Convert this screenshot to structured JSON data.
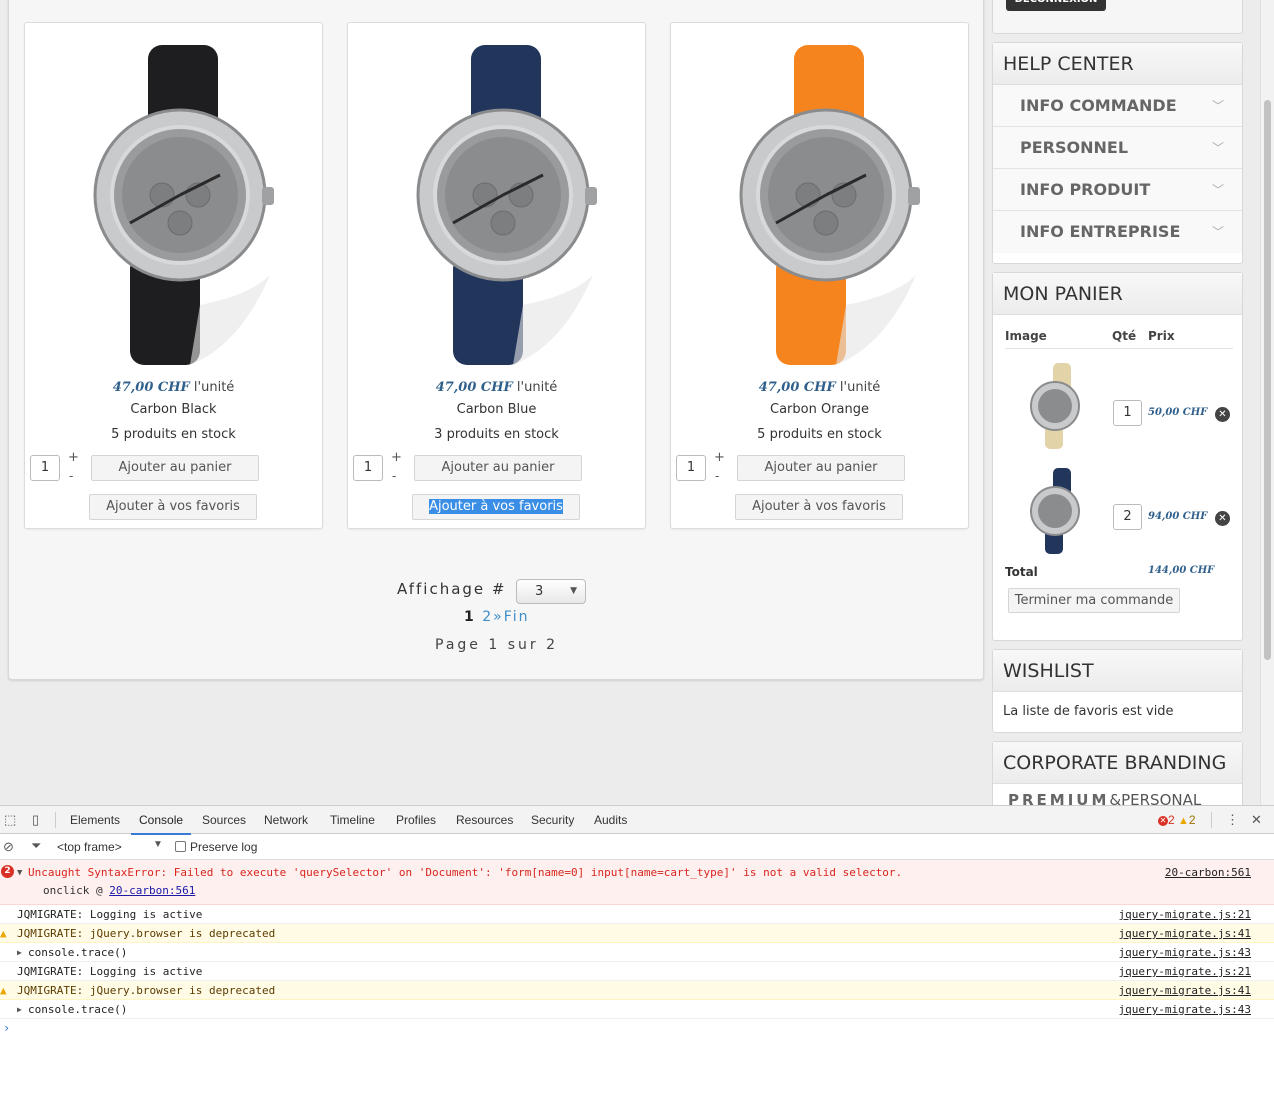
{
  "products": [
    {
      "price": "47,00 CHF",
      "unit": "l'unité",
      "name": "Carbon Black",
      "stock": "5 produits en stock",
      "qty": "1",
      "plus": "+",
      "minus": "-",
      "add_cart": "Ajouter au panier",
      "add_fav": "Ajouter à vos favoris",
      "strap_color": "#1e1e20"
    },
    {
      "price": "47,00 CHF",
      "unit": "l'unité",
      "name": "Carbon Blue",
      "stock": "3 produits en stock",
      "qty": "1",
      "plus": "+",
      "minus": "-",
      "add_cart": "Ajouter au panier",
      "add_fav": "Ajouter à vos favoris",
      "strap_color": "#22365c"
    },
    {
      "price": "47,00 CHF",
      "unit": "l'unité",
      "name": "Carbon Orange",
      "stock": "5 produits en stock",
      "qty": "1",
      "plus": "+",
      "minus": "-",
      "add_cart": "Ajouter au panier",
      "add_fav": "Ajouter à vos favoris",
      "strap_color": "#f5841f"
    }
  ],
  "pagination": {
    "affichage_label": "Affichage #",
    "affichage_value": "3",
    "page_current": "1",
    "page_next": "2",
    "next_arrow": "»",
    "last": "Fin",
    "page_of": "Page 1 sur 2"
  },
  "sidebar": {
    "logout": "DÉCONNEXION",
    "help_title": "HELP CENTER",
    "help_items": [
      "INFO COMMANDE",
      "PERSONNEL",
      "INFO PRODUIT",
      "INFO ENTREPRISE"
    ],
    "cart_title": "MON PANIER",
    "cart_headers": {
      "image": "Image",
      "qty": "Qté",
      "price": "Prix"
    },
    "cart_items": [
      {
        "qty": "1",
        "price": "50,00 CHF",
        "strap_color": "#e3d3a8"
      },
      {
        "qty": "2",
        "price": "94,00 CHF",
        "strap_color": "#22365c"
      }
    ],
    "total_label": "Total",
    "total_value": "144,00 CHF",
    "checkout": "Terminer ma commande",
    "wishlist_title": "WISHLIST",
    "wishlist_empty": "La liste de favoris est vide",
    "branding_title": "CORPORATE BRANDING",
    "branding_premium": "PREMIUM",
    "branding_amp": "&",
    "branding_personal": "PERSONAL"
  },
  "devtools": {
    "tabs": [
      "Elements",
      "Console",
      "Sources",
      "Network",
      "Timeline",
      "Profiles",
      "Resources",
      "Security",
      "Audits"
    ],
    "active_tab": "Console",
    "error_count": "2",
    "warning_count": "2",
    "frame": "<top frame>",
    "preserve_log": "Preserve log",
    "error": {
      "message": "Uncaught SyntaxError: Failed to execute 'querySelector' on 'Document': 'form[name=0] input[name=cart_type]' is not a valid selector.",
      "onclick_prefix": "onclick @ ",
      "onclick_link": "20-carbon:561",
      "source": "20-carbon:561"
    },
    "logs": [
      {
        "type": "log",
        "text": "JQMIGRATE: Logging is active",
        "source": "jquery-migrate.js:21"
      },
      {
        "type": "warn",
        "text": "JQMIGRATE: jQuery.browser is deprecated",
        "source": "jquery-migrate.js:41"
      },
      {
        "type": "trace",
        "text": "console.trace()",
        "source": "jquery-migrate.js:43"
      },
      {
        "type": "log",
        "text": "JQMIGRATE: Logging is active",
        "source": "jquery-migrate.js:21"
      },
      {
        "type": "warn",
        "text": "JQMIGRATE: jQuery.browser is deprecated",
        "source": "jquery-migrate.js:41"
      },
      {
        "type": "trace",
        "text": "console.trace()",
        "source": "jquery-migrate.js:43"
      }
    ],
    "prompt": "›"
  }
}
